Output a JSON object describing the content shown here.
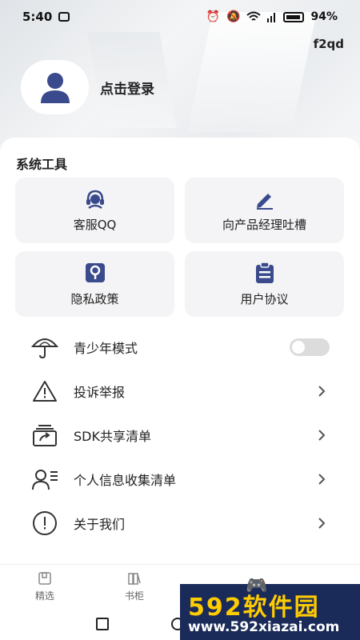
{
  "status": {
    "time": "5:40",
    "battery": "94%"
  },
  "header": {
    "code": "f2qd",
    "login_text": "点击登录"
  },
  "tools": {
    "title": "系统工具",
    "items": [
      {
        "label": "客服QQ",
        "icon": "headset-icon"
      },
      {
        "label": "向产品经理吐槽",
        "icon": "pen-icon"
      },
      {
        "label": "隐私政策",
        "icon": "keyhole-icon"
      },
      {
        "label": "用户协议",
        "icon": "clipboard-icon"
      }
    ]
  },
  "list": {
    "items": [
      {
        "label": "青少年模式",
        "icon": "umbrella-icon",
        "control": "toggle",
        "value": false
      },
      {
        "label": "投诉举报",
        "icon": "warning-icon",
        "control": "chevron"
      },
      {
        "label": "SDK共享清单",
        "icon": "share-box-icon",
        "control": "chevron"
      },
      {
        "label": "个人信息收集清单",
        "icon": "user-list-icon",
        "control": "chevron"
      },
      {
        "label": "关于我们",
        "icon": "info-circle-icon",
        "control": "chevron"
      }
    ]
  },
  "tabs": [
    {
      "label": "精选",
      "icon": "book-icon"
    },
    {
      "label": "书柜",
      "icon": "books-icon"
    }
  ],
  "watermark": {
    "brand": "592软件园",
    "url": "www.592xiazai.com"
  },
  "colors": {
    "accent": "#3a4a8c",
    "background": "#f3f3f3",
    "tile": "#f4f4f6"
  }
}
